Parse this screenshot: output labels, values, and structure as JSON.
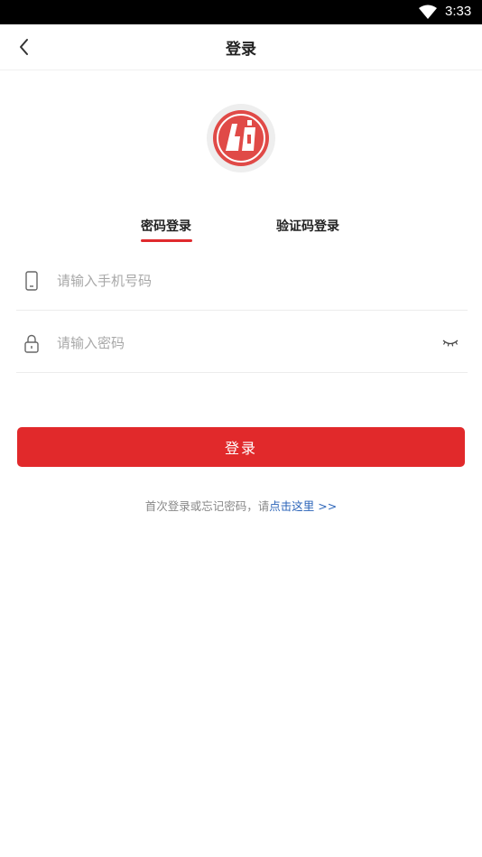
{
  "status_bar": {
    "time": "3:33"
  },
  "nav": {
    "title": "登录"
  },
  "tabs": [
    {
      "label": "密码登录",
      "active": true
    },
    {
      "label": "验证码登录",
      "active": false
    }
  ],
  "form": {
    "phone_placeholder": "请输入手机号码",
    "password_placeholder": "请输入密码",
    "login_label": "登录"
  },
  "hint": {
    "text": "首次登录或忘记密码，请",
    "link_text": "点击这里 >>"
  },
  "colors": {
    "accent": "#e1292b",
    "link": "#2a63b8"
  },
  "icons": [
    "wifi-icon",
    "back-arrow-icon",
    "phone-icon",
    "lock-icon",
    "eye-closed-icon"
  ]
}
